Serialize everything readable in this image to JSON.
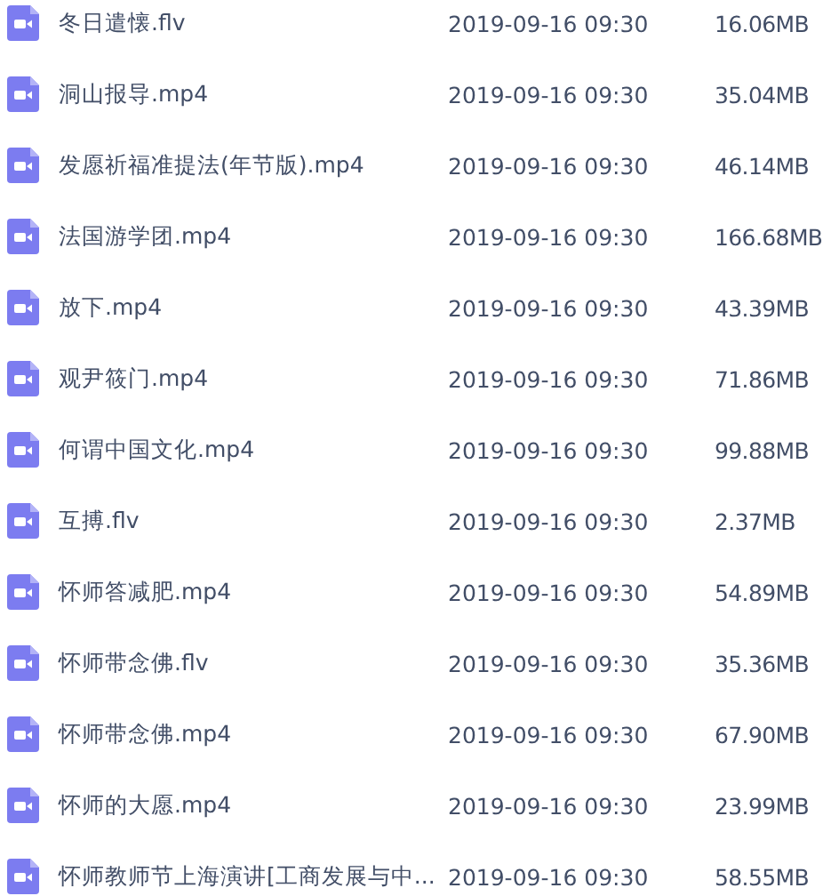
{
  "files": [
    {
      "name": "冬日遣懐.flv",
      "modified": "2019-09-16 09:30",
      "size": "16.06MB"
    },
    {
      "name": "洞山报导.mp4",
      "modified": "2019-09-16 09:30",
      "size": "35.04MB"
    },
    {
      "name": "发愿祈福准提法(年节版).mp4",
      "modified": "2019-09-16 09:30",
      "size": "46.14MB"
    },
    {
      "name": "法国游学团.mp4",
      "modified": "2019-09-16 09:30",
      "size": "166.68MB"
    },
    {
      "name": "放下.mp4",
      "modified": "2019-09-16 09:30",
      "size": "43.39MB"
    },
    {
      "name": "观尹筱门.mp4",
      "modified": "2019-09-16 09:30",
      "size": "71.86MB"
    },
    {
      "name": "何谓中国文化.mp4",
      "modified": "2019-09-16 09:30",
      "size": "99.88MB"
    },
    {
      "name": "互搏.flv",
      "modified": "2019-09-16 09:30",
      "size": "2.37MB"
    },
    {
      "name": "怀师答减肥.mp4",
      "modified": "2019-09-16 09:30",
      "size": "54.89MB"
    },
    {
      "name": "怀师带念佛.flv",
      "modified": "2019-09-16 09:30",
      "size": "35.36MB"
    },
    {
      "name": "怀师带念佛.mp4",
      "modified": "2019-09-16 09:30",
      "size": "67.90MB"
    },
    {
      "name": "怀师的大愿.mp4",
      "modified": "2019-09-16 09:30",
      "size": "23.99MB"
    },
    {
      "name": "怀师教师节上海演讲[工商发展与中...",
      "modified": "2019-09-16 09:30",
      "size": "58.55MB"
    }
  ]
}
